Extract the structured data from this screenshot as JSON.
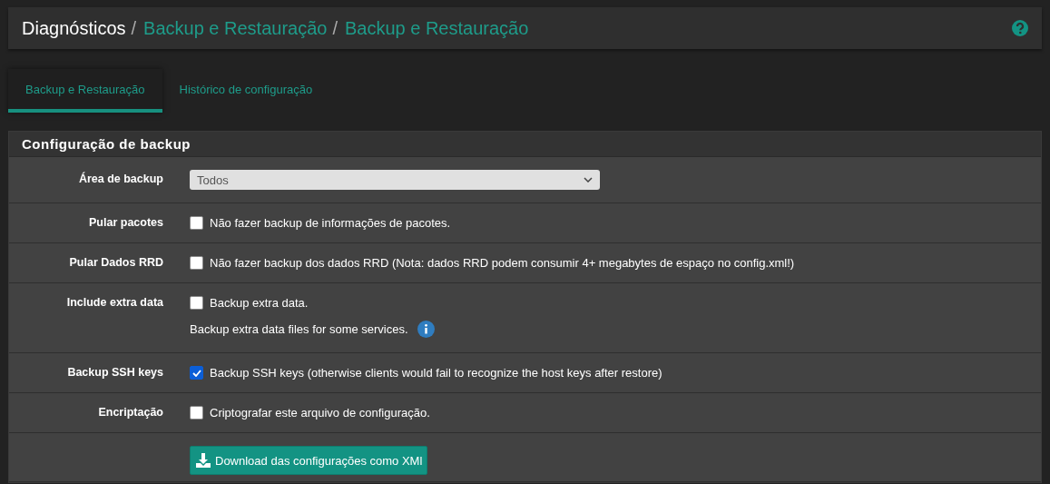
{
  "breadcrumb_separator": "/",
  "breadcrumb": [
    {
      "label": "Diagnósticos",
      "kind": "plain"
    },
    {
      "label": "Backup e Restauração",
      "kind": "link"
    },
    {
      "label": "Backup e Restauração",
      "kind": "link"
    }
  ],
  "tabs": [
    {
      "label": "Backup e Restauração",
      "selected": true
    },
    {
      "label": "Histórico de configuração",
      "selected": false
    }
  ],
  "panel": {
    "title": "Configuração de backup",
    "rows": [
      {
        "kind": "select",
        "label": "Área de backup",
        "value": "Todos"
      },
      {
        "kind": "checkbox",
        "label": "Pular pacotes",
        "text": "Não fazer backup de informações de pacotes.",
        "checked": false
      },
      {
        "kind": "checkbox",
        "label": "Pular Dados RRD",
        "text": "Não fazer backup dos dados RRD (Nota: dados RRD podem consumir 4+ megabytes de espaço no config.xml!)",
        "checked": false
      },
      {
        "kind": "checkbox",
        "label": "Include extra data",
        "text": "Backup extra data.",
        "checked": false,
        "help": "Backup extra data files for some services."
      },
      {
        "kind": "checkbox",
        "label": "Backup SSH keys",
        "text": "Backup SSH keys (otherwise clients would fail to recognize the host keys after restore)",
        "checked": true
      },
      {
        "kind": "checkbox",
        "label": "Encriptação",
        "text": "Criptografar este arquivo de configuração.",
        "checked": false
      },
      {
        "kind": "button",
        "label": "Download das configurações como XMl"
      }
    ]
  }
}
